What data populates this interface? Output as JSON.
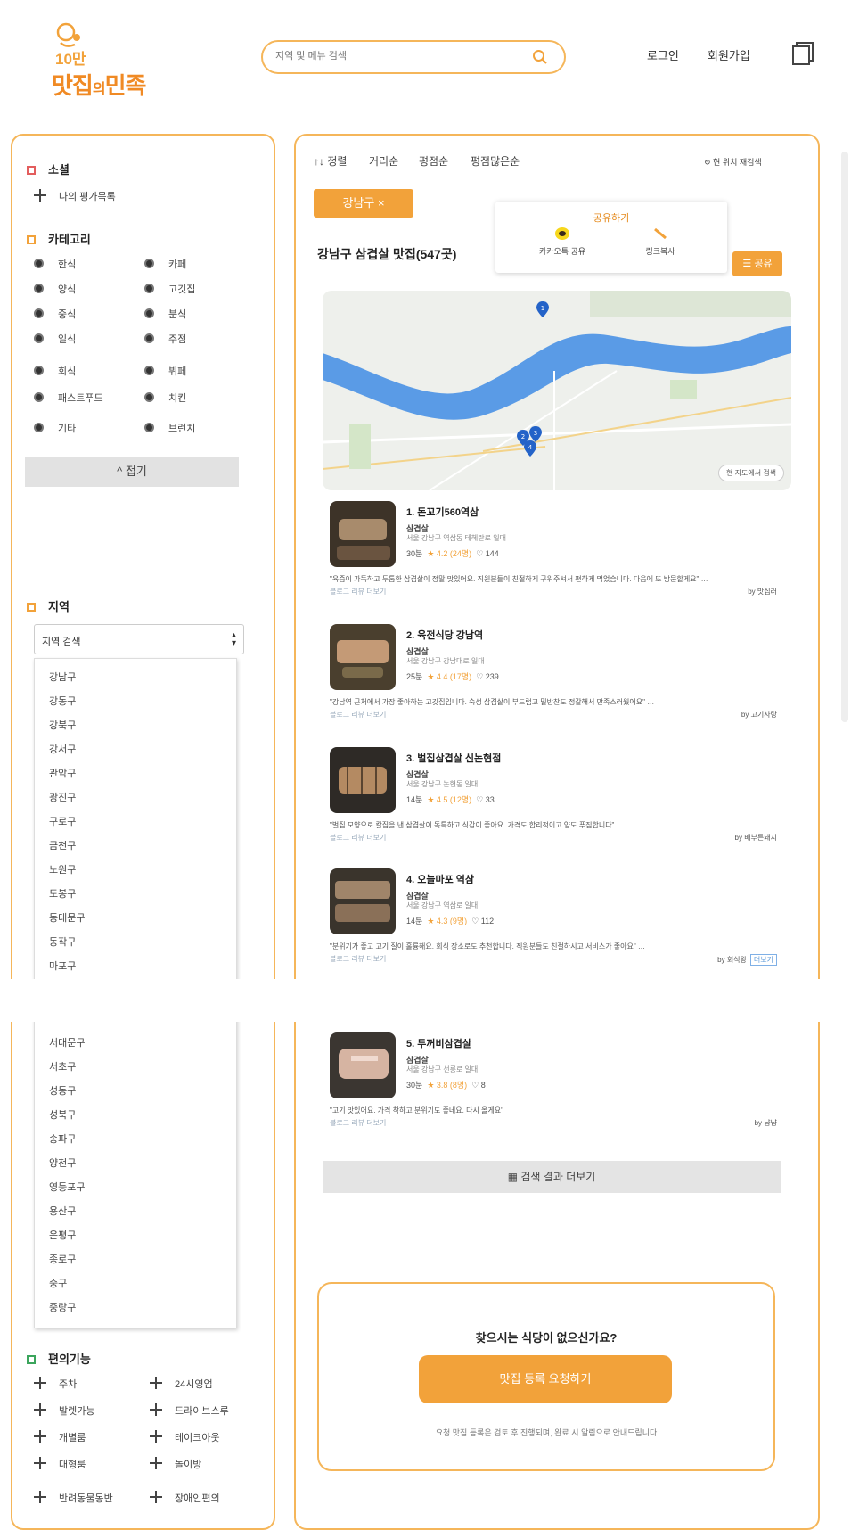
{
  "brand": {
    "logo_small": "10만",
    "logo_main_1": "맛집",
    "logo_main_2": "의",
    "logo_main_3": "민족"
  },
  "header": {
    "search_placeholder": "지역 및 메뉴 검색",
    "login": "로그인",
    "signup": "회원가입"
  },
  "sidebar": {
    "social_title": "소셜",
    "social_items": [
      "나의 평가목록"
    ],
    "category_title": "카테고리",
    "categories": [
      "한식",
      "카페",
      "양식",
      "고깃집",
      "중식",
      "분식",
      "일식",
      "주점",
      "회식",
      "뷔페",
      "패스트푸드",
      "치킨",
      "기타",
      "브런치"
    ],
    "fold_label": "^ 접기",
    "region_title": "지역",
    "region_select_value": "지역 검색",
    "regions": [
      "강남구",
      "강동구",
      "강북구",
      "강서구",
      "관악구",
      "광진구",
      "구로구",
      "금천구",
      "노원구",
      "도봉구",
      "동대문구",
      "동작구",
      "마포구",
      "서대문구",
      "서초구",
      "성동구",
      "성북구",
      "송파구",
      "양천구",
      "영등포구",
      "용산구",
      "은평구",
      "종로구",
      "중구",
      "중랑구"
    ],
    "amenity_title": "편의기능",
    "amenities": [
      "주차",
      "24시영업",
      "발렛가능",
      "드라이브스루",
      "개별룸",
      "테이크아웃",
      "대형룸",
      "놀이방",
      "반려동물동반",
      "장애인편의"
    ]
  },
  "results": {
    "sort_tabs": [
      "↑↓ 정렬",
      "거리순",
      "평점순",
      "평점많은순"
    ],
    "right_link": "↻ 현 위치 재검색",
    "region_chip": "강남구 ×",
    "share_popup_title": "공유하기",
    "share_options": [
      "카카오톡 공유",
      "링크복사"
    ],
    "list_title": "강남구 삼겹살 맛집(547곳)",
    "share_btn": "☰ 공유",
    "map_label": "현 지도에서 검색",
    "cards": [
      {
        "name": "1. 돈꼬기560역삼",
        "cat": "삼겹살",
        "addr": "서울 강남구 역삼동 테헤란로 일대",
        "rating": "★ 4.2 (24명)",
        "dist": "30분",
        "views": "♡ 144",
        "review": "\"육즙이 가득하고 두툼한 삼겹살이 정말 맛있어요. 직원분들이 친절하게 구워주셔서 편하게 먹었습니다. 다음에 또 방문할게요\" …",
        "review2": "블로그 리뷰 더보기",
        "author": "by 맛집러"
      },
      {
        "name": "2. 육전식당 강남역",
        "cat": "삼겹살",
        "addr": "서울 강남구 강남대로 일대",
        "rating": "★ 4.4 (17명)",
        "dist": "25분",
        "views": "♡ 239",
        "review": "\"강남역 근처에서 가장 좋아하는 고깃집입니다. 숙성 삼겹살이 부드럽고 밑반찬도 정갈해서 만족스러웠어요\" …",
        "review2": "블로그 리뷰 더보기",
        "author": "by 고기사랑"
      },
      {
        "name": "3. 벌집삼겹살 신논현점",
        "cat": "삼겹살",
        "addr": "서울 강남구 논현동 일대",
        "rating": "★ 4.5 (12명)",
        "dist": "14분",
        "views": "♡ 33",
        "review": "\"벌집 모양으로 칼집을 낸 삼겹살이 독특하고 식감이 좋아요. 가격도 합리적이고 양도 푸짐합니다\" …",
        "review2": "블로그 리뷰 더보기",
        "author": "by 배부른돼지"
      },
      {
        "name": "4. 오늘마포 역삼",
        "cat": "삼겹살",
        "addr": "서울 강남구 역삼로 일대",
        "rating": "★ 4.3 (9명)",
        "dist": "14분",
        "views": "♡ 112",
        "review": "\"분위기가 좋고 고기 질이 훌륭해요. 회식 장소로도 추천합니다. 직원분들도 친절하시고 서비스가 좋아요\" …",
        "review2": "블로그 리뷰 더보기",
        "author": "by 회식왕",
        "tag": "더보기"
      },
      {
        "name": "5. 두꺼비삼겹살",
        "cat": "삼겹살",
        "addr": "서울 강남구 선릉로 일대",
        "rating": "★ 3.8 (8명)",
        "dist": "30분",
        "views": "♡ 8",
        "review": "\"고기 맛있어요. 가격 착하고 분위기도 좋네요. 다시 올게요\"",
        "review2": "블로그 리뷰 더보기",
        "author": "by 냠냠"
      }
    ],
    "more_btn": "▦ 검색 결과 더보기"
  },
  "cta": {
    "title": "찾으시는 식당이 없으신가요?",
    "button": "맛집 등록 요청하기",
    "note": "요청 맛집 등록은 검토 후 진행되며, 완료 시 알림으로 안내드립니다"
  }
}
